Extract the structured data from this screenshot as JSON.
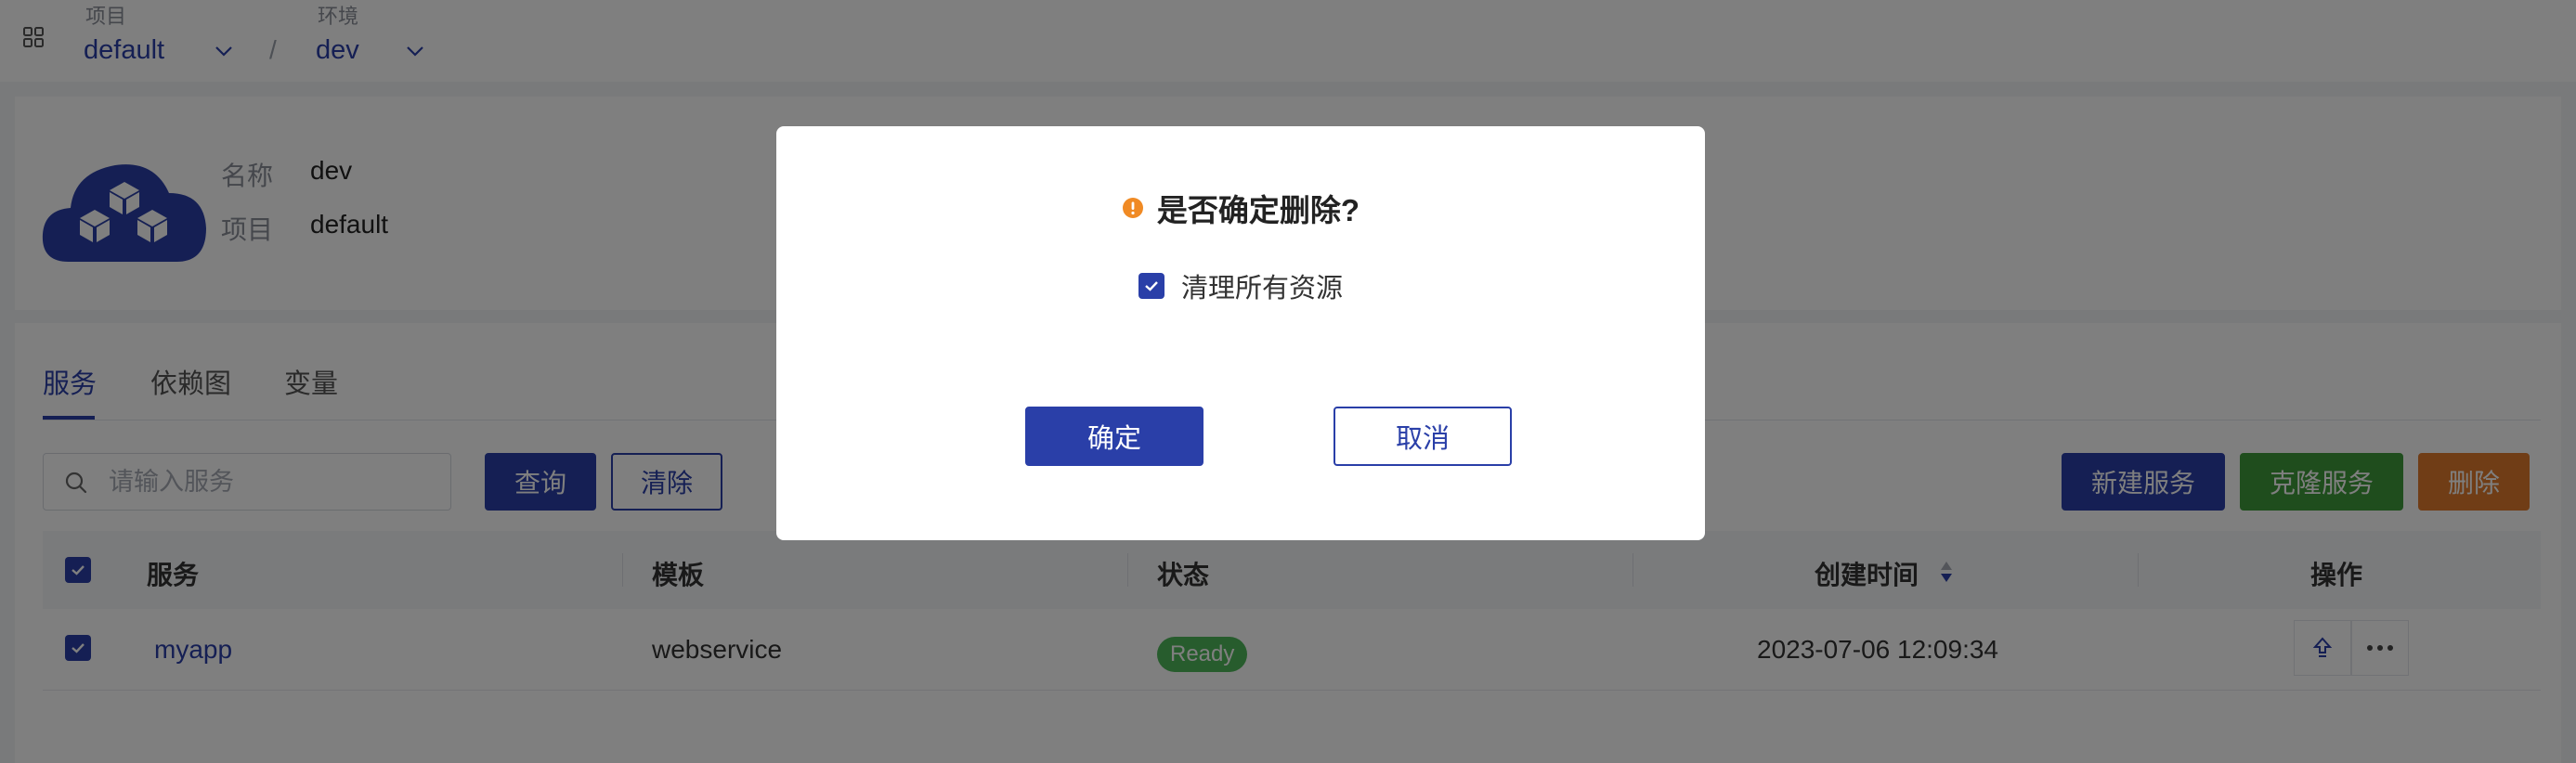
{
  "topbar": {
    "project_label": "项目",
    "project_value": "default",
    "env_label": "环境",
    "env_value": "dev",
    "separator": "/"
  },
  "info": {
    "name_label": "名称",
    "name_value": "dev",
    "project_label": "项目",
    "project_value": "default"
  },
  "tabs": [
    "服务",
    "依赖图",
    "变量"
  ],
  "active_tab": "服务",
  "search": {
    "placeholder": "请输入服务"
  },
  "toolbar": {
    "query_label": "查询",
    "clear_label": "清除",
    "new_label": "新建服务",
    "clone_label": "克隆服务",
    "delete_label": "删除"
  },
  "table": {
    "columns": [
      "服务",
      "模板",
      "状态",
      "创建时间",
      "操作"
    ],
    "rows": [
      {
        "service": "myapp",
        "template": "webservice",
        "status": "Ready",
        "created": "2023-07-06 12:09:34",
        "checked": true
      }
    ],
    "all_checked": true
  },
  "modal": {
    "title": "是否确定删除?",
    "checkbox_label": "清理所有资源",
    "checkbox_checked": true,
    "confirm_label": "确定",
    "cancel_label": "取消"
  },
  "colors": {
    "primary": "#2a3fa8",
    "success": "#3f9b3a",
    "danger": "#e07b2c",
    "warning_icon": "#f08a24",
    "status_ready": "#4fb85a"
  },
  "icons": {
    "apps": "grid-apps-icon",
    "chevron": "chevron-down-icon",
    "search": "search-icon",
    "sort": "sort-icon",
    "upgrade": "upgrade-icon",
    "more": "more-icon",
    "warning": "warning-icon",
    "check": "check-icon",
    "cloud": "cloud-cubes-icon"
  }
}
